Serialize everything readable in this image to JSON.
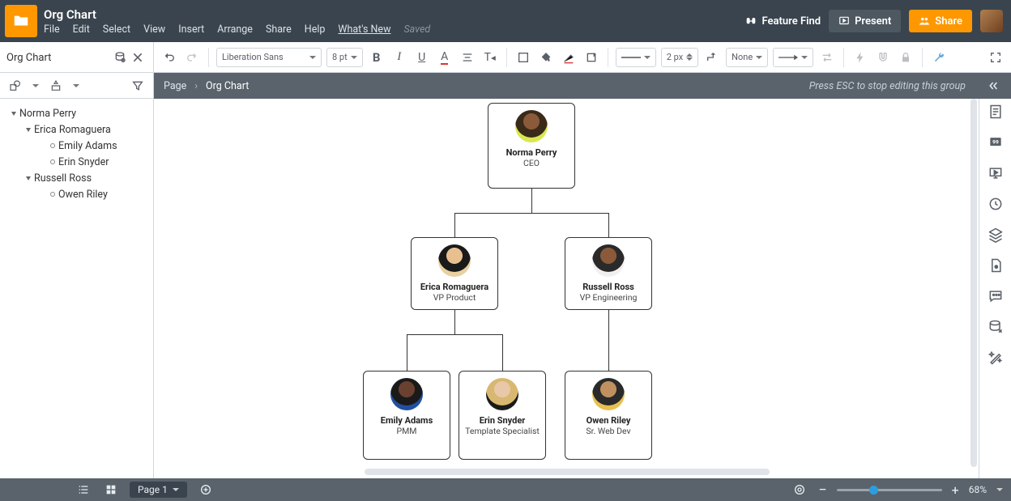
{
  "doc": {
    "title": "Org Chart",
    "saved": "Saved"
  },
  "menu": [
    "File",
    "Edit",
    "Select",
    "View",
    "Insert",
    "Arrange",
    "Share",
    "Help",
    "What's New"
  ],
  "header_right": {
    "feature_find": "Feature Find",
    "present": "Present",
    "share": "Share"
  },
  "left_panel_title": "Org Chart",
  "toolbar": {
    "font": "Liberation Sans",
    "font_size": "8 pt",
    "line_width": "2 px",
    "endpoint": "None"
  },
  "breadcrumb": {
    "root": "Page",
    "current": "Org Chart",
    "hint": "Press ESC to stop editing this group"
  },
  "outline": {
    "root": {
      "name": "Norma Perry"
    },
    "l1a": {
      "name": "Erica Romaguera"
    },
    "l2a": {
      "name": "Emily Adams"
    },
    "l2b": {
      "name": "Erin Snyder"
    },
    "l1b": {
      "name": "Russell Ross"
    },
    "l2c": {
      "name": "Owen Riley"
    }
  },
  "cards": {
    "c1": {
      "name": "Norma Perry",
      "role": "CEO"
    },
    "c2": {
      "name": "Erica Romaguera",
      "role": "VP Product"
    },
    "c3": {
      "name": "Russell Ross",
      "role": "VP Engineering"
    },
    "c4": {
      "name": "Emily Adams",
      "role": "PMM"
    },
    "c5": {
      "name": "Erin Snyder",
      "role": "Template Specialist"
    },
    "c6": {
      "name": "Owen Riley",
      "role": "Sr. Web Dev"
    }
  },
  "bottom": {
    "page_label": "Page 1",
    "zoom": "68%"
  }
}
